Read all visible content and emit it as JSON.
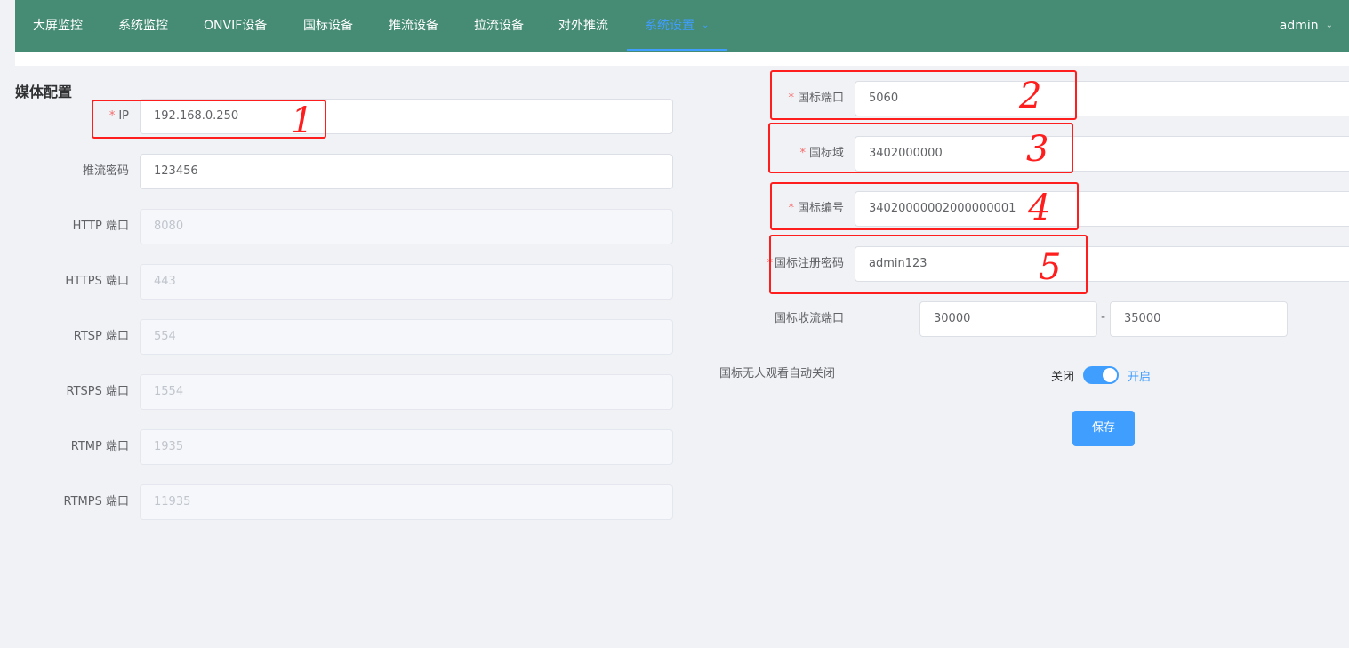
{
  "nav": {
    "items": [
      "大屏监控",
      "系统监控",
      "ONVIF设备",
      "国标设备",
      "推流设备",
      "拉流设备",
      "对外推流",
      "系统设置"
    ],
    "active": "系统设置",
    "user": "admin"
  },
  "section_title": "媒体配置",
  "left_form": {
    "ip": {
      "label": "IP",
      "value": "192.168.0.250"
    },
    "push_secret": {
      "label": "推流密码",
      "value": "123456"
    },
    "http_port": {
      "label": "HTTP 端口",
      "value": "8080"
    },
    "https_port": {
      "label": "HTTPS 端口",
      "value": "443"
    },
    "rtsp_port": {
      "label": "RTSP 端口",
      "value": "554"
    },
    "rtsps_port": {
      "label": "RTSPS 端口",
      "value": "1554"
    },
    "rtmp_port": {
      "label": "RTMP 端口",
      "value": "1935"
    },
    "rtmps_port": {
      "label": "RTMPS 端口",
      "value": "11935"
    }
  },
  "right_form": {
    "gb_port": {
      "label": "国标端口",
      "value": "5060"
    },
    "gb_domain": {
      "label": "国标域",
      "value": "3402000000"
    },
    "gb_id": {
      "label": "国标编号",
      "value": "34020000002000000001"
    },
    "gb_password": {
      "label": "国标注册密码",
      "value": "admin123"
    },
    "gb_rtp_range": {
      "label": "国标收流端口",
      "start": "30000",
      "end": "35000",
      "separator": "-"
    },
    "gb_auto_close": {
      "label": "国标无人观看自动关闭",
      "off_text": "关闭",
      "on_text": "开启",
      "enabled": true
    },
    "save_label": "保存"
  },
  "annotations": [
    "1",
    "2",
    "3",
    "4",
    "5"
  ],
  "colors": {
    "nav_bg": "#468b74",
    "accent": "#409eff",
    "annotation": "#ff1e1e",
    "required": "#f56c6c"
  }
}
